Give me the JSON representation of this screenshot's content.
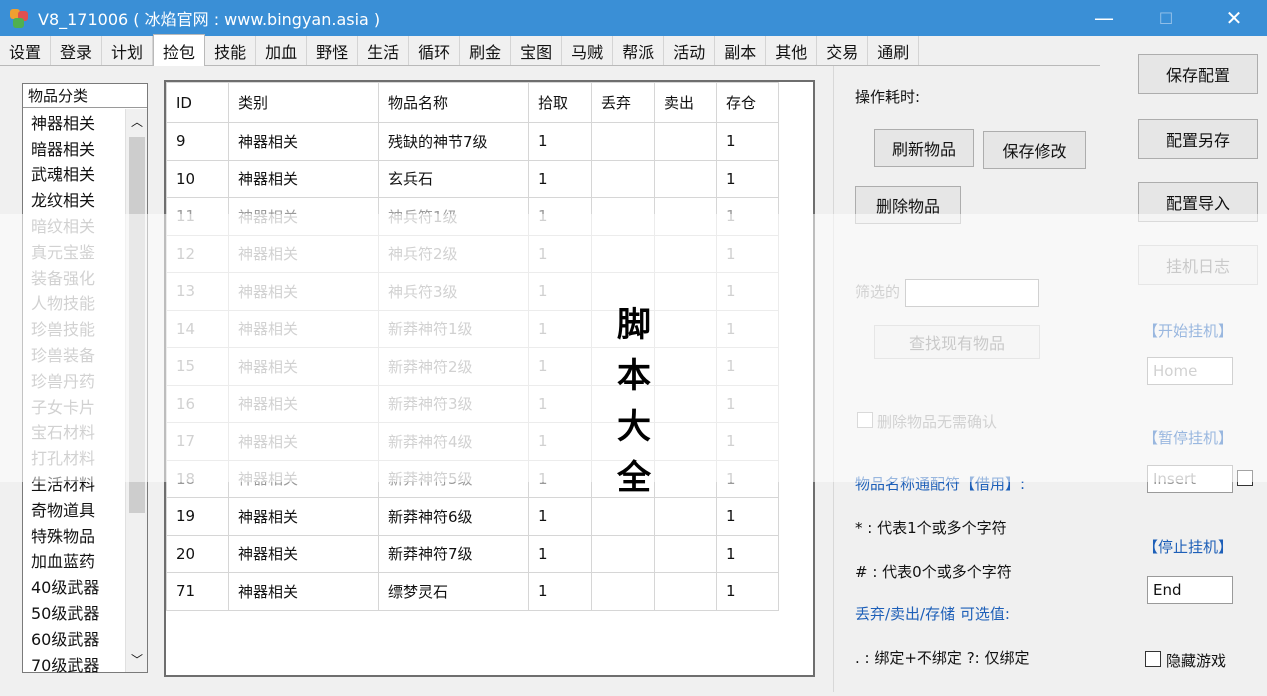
{
  "window": {
    "title": "V8_171006 ( 冰焰官网 : www.bingyan.asia )"
  },
  "tabs": [
    "设置",
    "登录",
    "计划",
    "捡包",
    "技能",
    "加血",
    "野怪",
    "生活",
    "循环",
    "刷金",
    "宝图",
    "马贼",
    "帮派",
    "活动",
    "副本",
    "其他",
    "交易",
    "通刷"
  ],
  "active_tab_index": 3,
  "categories": {
    "header": "物品分类",
    "items": [
      "神器相关",
      "暗器相关",
      "武魂相关",
      "龙纹相关",
      "暗纹相关",
      "真元宝鉴",
      "装备强化",
      "人物技能",
      "珍兽技能",
      "珍兽装备",
      "珍兽丹药",
      "子女卡片",
      "宝石材料",
      "打孔材料",
      "生活材料",
      "奇物道具",
      "特殊物品",
      "加血蓝药",
      "40级武器",
      "50级武器",
      "60级武器",
      "70级武器"
    ]
  },
  "grid": {
    "headers": [
      "ID",
      "类别",
      "物品名称",
      "拾取",
      "丢弃",
      "卖出",
      "存仓"
    ],
    "rows": [
      {
        "id": "9",
        "type": "神器相关",
        "name": "残缺的神节7级",
        "pick": "1",
        "drop": "",
        "sell": "",
        "store": "1"
      },
      {
        "id": "10",
        "type": "神器相关",
        "name": "玄兵石",
        "pick": "1",
        "drop": "",
        "sell": "",
        "store": "1"
      },
      {
        "id": "11",
        "type": "神器相关",
        "name": "神兵符1级",
        "pick": "1",
        "drop": "",
        "sell": "",
        "store": "1"
      },
      {
        "id": "12",
        "type": "神器相关",
        "name": "神兵符2级",
        "pick": "1",
        "drop": "",
        "sell": "",
        "store": "1"
      },
      {
        "id": "13",
        "type": "神器相关",
        "name": "神兵符3级",
        "pick": "1",
        "drop": "",
        "sell": "",
        "store": "1"
      },
      {
        "id": "14",
        "type": "神器相关",
        "name": "新莽神符1级",
        "pick": "1",
        "drop": "",
        "sell": "",
        "store": "1"
      },
      {
        "id": "15",
        "type": "神器相关",
        "name": "新莽神符2级",
        "pick": "1",
        "drop": "",
        "sell": "",
        "store": "1"
      },
      {
        "id": "16",
        "type": "神器相关",
        "name": "新莽神符3级",
        "pick": "1",
        "drop": "",
        "sell": "",
        "store": "1"
      },
      {
        "id": "17",
        "type": "神器相关",
        "name": "新莽神符4级",
        "pick": "1",
        "drop": "",
        "sell": "",
        "store": "1"
      },
      {
        "id": "18",
        "type": "神器相关",
        "name": "新莽神符5级",
        "pick": "1",
        "drop": "",
        "sell": "",
        "store": "1"
      },
      {
        "id": "19",
        "type": "神器相关",
        "name": "新莽神符6级",
        "pick": "1",
        "drop": "",
        "sell": "",
        "store": "1"
      },
      {
        "id": "20",
        "type": "神器相关",
        "name": "新莽神符7级",
        "pick": "1",
        "drop": "",
        "sell": "",
        "store": "1"
      },
      {
        "id": "71",
        "type": "神器相关",
        "name": "缥梦灵石",
        "pick": "1",
        "drop": "",
        "sell": "",
        "store": "1"
      }
    ]
  },
  "ops": {
    "label": "操作耗时:",
    "refresh_button": "刷新物品",
    "save_edit_button": "保存修改",
    "delete_button": "删除物品",
    "filter_label": "筛选的",
    "find_button": "查找现有物品",
    "delete_no_confirm": "删除物品无需确认",
    "wildcard_title": "物品名称通配符【借用】:",
    "wildcard_star": "* : 代表1个或多个字符",
    "wildcard_hash": "# : 代表0个或多个字符",
    "options_title": "丢弃/卖出/存储 可选值:",
    "options_desc": ". : 绑定+不绑定   ?: 仅绑定"
  },
  "right": {
    "save_config": "保存配置",
    "save_as": "配置另存",
    "import": "配置导入",
    "log": "挂机日志",
    "start_label": "【开始挂机】",
    "start_key": "Home",
    "pause_label": "【暂停挂机】",
    "pause_key": "Insert",
    "stop_label": "【停止挂机】",
    "stop_key": "End",
    "hide_game": "隐藏游戏"
  },
  "watermark": [
    "脚",
    "本",
    "大",
    "全"
  ],
  "colors": {
    "titlebar": "#3a8fd6",
    "accent_blue": "#1d5fb8"
  }
}
